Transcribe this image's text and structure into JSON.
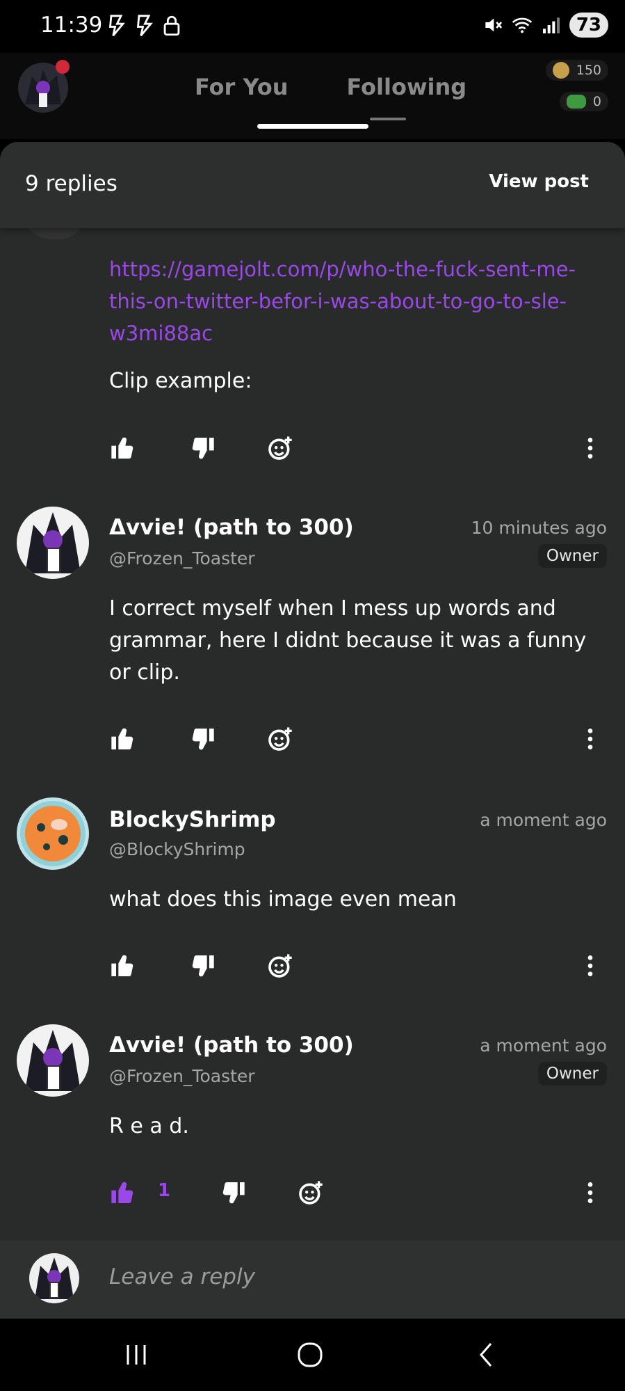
{
  "status_bar": {
    "time": "11:39",
    "battery": "73"
  },
  "top_bar": {
    "tabs": [
      {
        "label": "For You"
      },
      {
        "label": "Following"
      }
    ],
    "coins": "150",
    "gems": "0"
  },
  "sheet": {
    "replies_count": "9 replies",
    "view_post_label": "View post"
  },
  "first_reply_partial": {
    "link": "https://gamejolt.com/p/who-the-fuck-sent-me-this-on-twitter-befor-i-was-about-to-go-to-sle-w3mi88ac",
    "clip_text": "Clip example:"
  },
  "replies": [
    {
      "name": "Δvvie! (path to 300)",
      "handle": "@Frozen_Toaster",
      "time": "10 minutes ago",
      "badge": "Owner",
      "text": "I correct myself when I mess up words and grammar, here I didnt because it was a funny or clip."
    },
    {
      "name": "BlockyShrimp",
      "handle": "@BlockyShrimp",
      "time": "a moment ago",
      "text": "what does this image even mean"
    },
    {
      "name": "Δvvie! (path to 300)",
      "handle": "@Frozen_Toaster",
      "time": "a moment ago",
      "badge": "Owner",
      "text": "R e a d.",
      "like_count": "1"
    }
  ],
  "reply_bar": {
    "placeholder": "Leave a reply"
  },
  "colors": {
    "accent": "#9a48e8",
    "sheet_bg": "#292b2a"
  }
}
